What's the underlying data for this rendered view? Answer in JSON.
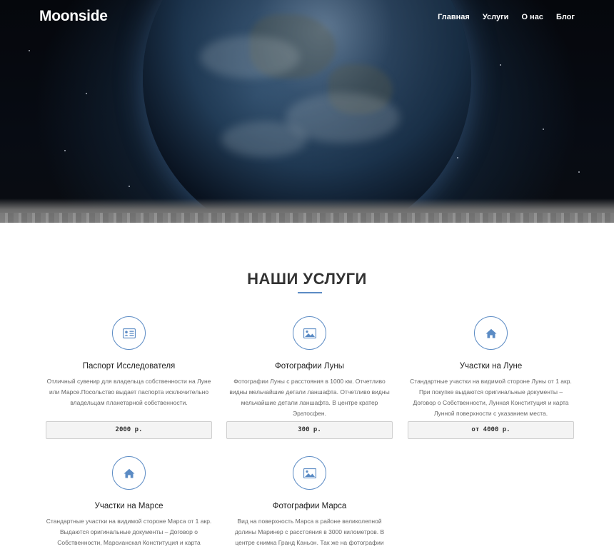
{
  "header": {
    "logo": "Moonside",
    "nav": [
      "Главная",
      "Услуги",
      "О нас",
      "Блог"
    ]
  },
  "services": {
    "title": "НАШИ УСЛУГИ",
    "accent_color": "#5b8bc4",
    "items": [
      {
        "icon": "id-card-icon",
        "title": "Паспорт Исследователя",
        "description": "Отличный сувенир для владельца собственности на Луне или Марсе.Посольство выдает паспорта исключительно владельцам планетарной собственности.",
        "price": "2000 р."
      },
      {
        "icon": "image-icon",
        "title": "Фотографии Луны",
        "description": "Фотографии Луны с расстояния в 1000 км. Отчетливо видны мельчайшие детали ланшафта. Отчетливо видны мельчайшие детали ланшафта. В центре кратер Эратосфен.",
        "price": "300 р."
      },
      {
        "icon": "home-icon",
        "title": "Участки на Луне",
        "description": "Стандартные участки на видимой стороне Луны от 1 акр. При покупке выдаются оригинальные документы – Договор о Собственности, Лунная Конституция и карта Лунной поверхности с указанием места.",
        "price": "от 4000 р."
      },
      {
        "icon": "home-icon",
        "title": "Участки на Марсе",
        "description": "Стандартные участки на видимой стороне Марса от 1 акр. Выдаются оригинальные документы – Договор о Собственности, Марсианская Конституция и карта"
      },
      {
        "icon": "image-icon",
        "title": "Фотографии Марса",
        "description": "Вид на поверхность Марса в районе великолепной долины Маринер с расстояния в 3000 километров. В центре снимка Гранд Каньон. Так же на фотографии"
      }
    ]
  }
}
